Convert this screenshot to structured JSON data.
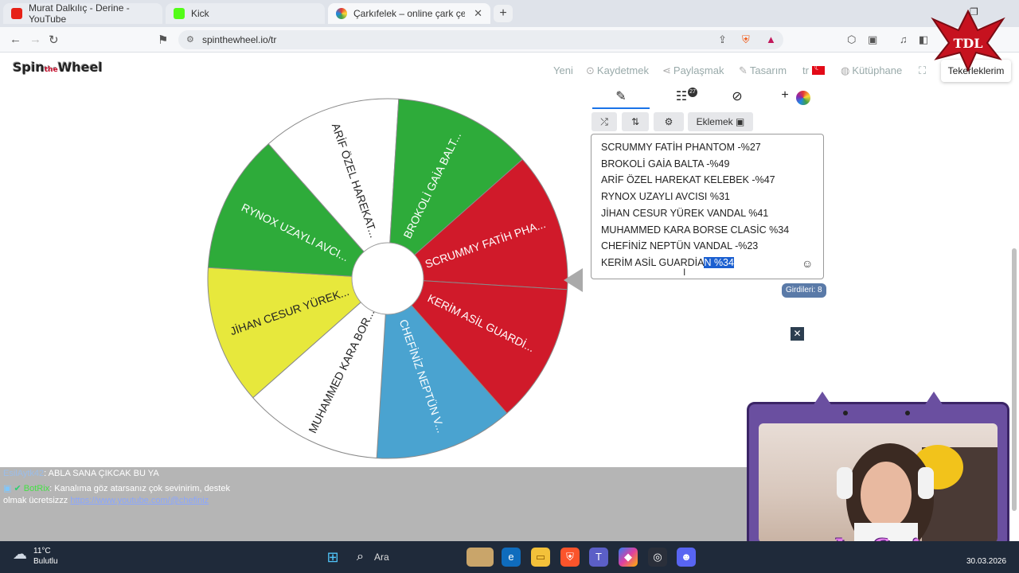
{
  "browser": {
    "tabs": [
      {
        "title": "Murat Dalkılıç - Derine - YouTube",
        "favicon_color": "#e62117"
      },
      {
        "title": "Kick",
        "favicon_color": "#53fc18"
      },
      {
        "title": "Çarkıfelek – online çark çevirme",
        "favicon_color": "#4285f4"
      }
    ],
    "url": "spinthewheel.io/tr"
  },
  "site": {
    "logo_prefix": "Spin",
    "logo_mid": "the",
    "logo_suffix": "Wheel",
    "nav": {
      "new": "Yeni",
      "save": "Kaydetmek",
      "share": "Paylaşmak",
      "design": "Tasarım",
      "lang": "tr",
      "library": "Kütüphane",
      "my_list": "Tekerleklerim"
    }
  },
  "wheel": {
    "segments": [
      {
        "label": "SCRUMMY FATİH PHA...",
        "color": "#d01a2a"
      },
      {
        "label": "KERİM ASİL GUARDİ...",
        "color": "#d01a2a"
      },
      {
        "label": "CHEFİNİZ NEPTÜN V...",
        "color": "#4aa3d0"
      },
      {
        "label": "MUHAMMED KARA BOR...",
        "color": "#ffffff"
      },
      {
        "label": "JİHAN CESUR YÜREK...",
        "color": "#e7e83c"
      },
      {
        "label": "RYNOX UZAYLI AVCI...",
        "color": "#2eab3a"
      },
      {
        "label": "ARİF ÖZEL HAREKAT...",
        "color": "#ffffff"
      },
      {
        "label": "BROKOLİ GAİA BALT...",
        "color": "#2eab3a"
      }
    ]
  },
  "panel": {
    "results_badge": "27",
    "add_label": "Eklemek",
    "entries": [
      "SCRUMMY FATİH PHANTOM -%27",
      "BROKOLİ GAİA BALTA -%49",
      "ARİF ÖZEL HAREKAT KELEBEK -%47",
      "RYNOX UZAYLI AVCISI %31",
      "JİHAN CESUR YÜREK VANDAL %41",
      "MUHAMMED KARA BORSE CLASİC %34",
      "CHEFİNİZ NEPTÜN VANDAL -%23"
    ],
    "last_entry_plain": "KERİM ASİL GUARDİA",
    "last_entry_selected": "N %34",
    "entry_count": "Girdileri: 8"
  },
  "chat": {
    "msg1_user": "EsilAytk42",
    "msg1_text": ": ABLA SANA ÇIKCAK BU YA",
    "msg2_user": "BotRix",
    "msg2_text": ": Kanalıma göz atarsanız çok sevinirim, destek",
    "msg2_cont": "olmak ücretsizzz",
    "msg2_link": "https://www.youtube.com/@chefiniz"
  },
  "stream": {
    "brand": "chefiniz",
    "logo_text": "TDL"
  },
  "taskbar": {
    "temp": "11°C",
    "weather": "Bulutlu",
    "search": "Ara",
    "date": "30.03.2026"
  }
}
